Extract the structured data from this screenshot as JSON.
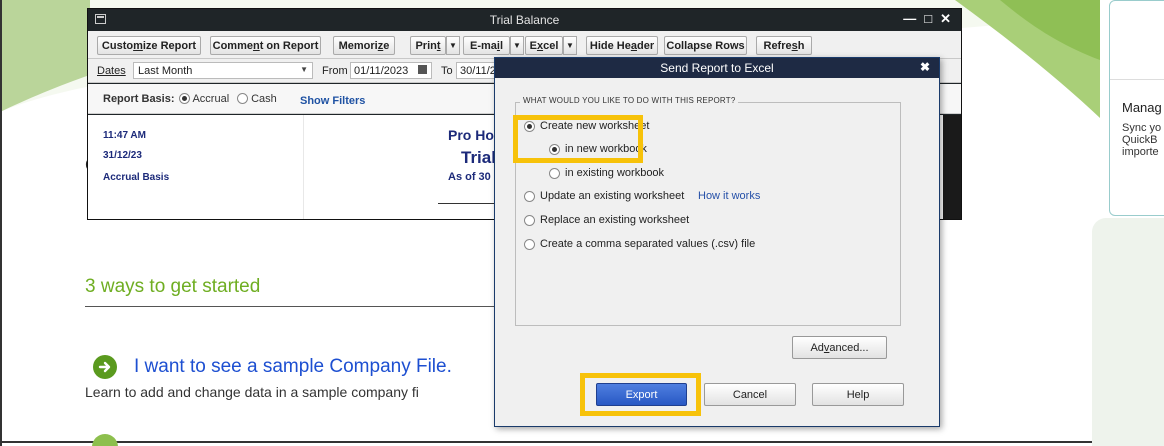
{
  "colors": {
    "accent_green": "#6fae22",
    "link_blue": "#1d4fd1",
    "highlight_yellow": "#f7c20a",
    "export_blue": "#2858c4",
    "report_navy": "#1c2a7a"
  },
  "background": {
    "stray_char": "C",
    "ways_title": "3 ways to get started",
    "sample_link": "I want to see a sample Company File.",
    "sample_sub": "Learn to add and change data in a sample company fi",
    "arrow_icon": "arrow-right-circle-icon",
    "right_card": {
      "title": "Manag",
      "body_lines": [
        "Sync yo",
        "QuickB",
        "importe"
      ]
    }
  },
  "trial_balance": {
    "title": "Trial Balance",
    "window_controls": [
      "minimize-icon",
      "maximize-icon",
      "close-icon"
    ],
    "toolbar": {
      "customize": {
        "pre": "Custo",
        "key": "m",
        "post": "ize Report"
      },
      "comment": {
        "pre": "Comme",
        "key": "n",
        "post": "t on Report"
      },
      "memorize": {
        "pre": "Memori",
        "key": "z",
        "post": "e"
      },
      "print": {
        "pre": "Prin",
        "key": "t",
        "post": ""
      },
      "email": {
        "pre": "E-ma",
        "key": "i",
        "post": "l"
      },
      "excel": {
        "pre": "E",
        "key": "x",
        "post": "cel"
      },
      "hide_header": {
        "pre": "Hide He",
        "key": "a",
        "post": "der"
      },
      "collapse_rows": {
        "pre": "Collapse Rows",
        "key": "",
        "post": ""
      },
      "refresh": {
        "pre": "Refre",
        "key": "s",
        "post": "h"
      }
    },
    "filters": {
      "dates_label": "Dates",
      "dates_value": "Last Month",
      "from_label": "From",
      "from_value": "01/11/2023",
      "to_label": "To",
      "to_value": "30/11/2023"
    },
    "basis": {
      "label": "Report Basis:",
      "accrual": "Accrual",
      "cash": "Cash",
      "selected": "Accrual",
      "show_filters": "Show Filters"
    },
    "report": {
      "time": "11:47 AM",
      "date": "31/12/23",
      "basis": "Accrual Basis",
      "company": "Pro Ho",
      "title": "Trial",
      "as_of": "As of 30 N"
    }
  },
  "dialog": {
    "title": "Send Report to Excel",
    "question": "WHAT WOULD YOU LIKE TO DO WITH THIS REPORT?",
    "options": {
      "create_new": "Create new worksheet",
      "in_new_workbook": "in new workbook",
      "in_existing_workbook": "in existing workbook",
      "update_existing": "Update an existing worksheet",
      "how_it_works": "How it works",
      "replace_existing": "Replace an existing worksheet",
      "create_csv": "Create a comma separated values (.csv) file"
    },
    "selected_option": "Create new worksheet",
    "selected_sub_option": "in new workbook",
    "buttons": {
      "advanced": {
        "pre": "Ad",
        "key": "v",
        "post": "anced..."
      },
      "export": "Export",
      "cancel": "Cancel",
      "help": "Help"
    }
  }
}
